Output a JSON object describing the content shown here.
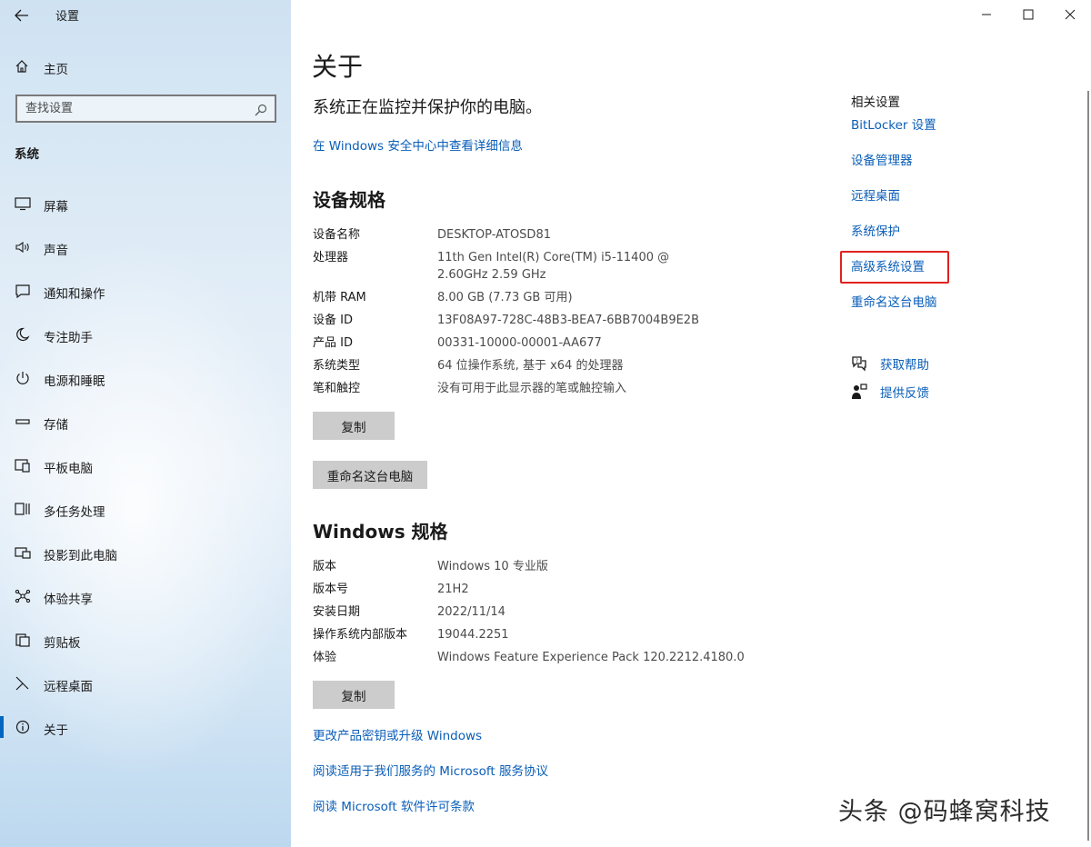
{
  "window": {
    "app_title": "设置"
  },
  "sidebar": {
    "home_label": "主页",
    "search_placeholder": "查找设置",
    "section_label": "系统",
    "items": [
      {
        "label": "屏幕",
        "icon": "monitor-icon"
      },
      {
        "label": "声音",
        "icon": "speaker-icon"
      },
      {
        "label": "通知和操作",
        "icon": "notification-icon"
      },
      {
        "label": "专注助手",
        "icon": "moon-icon"
      },
      {
        "label": "电源和睡眠",
        "icon": "power-icon"
      },
      {
        "label": "存储",
        "icon": "storage-icon"
      },
      {
        "label": "平板电脑",
        "icon": "tablet-icon"
      },
      {
        "label": "多任务处理",
        "icon": "multitask-icon"
      },
      {
        "label": "投影到此电脑",
        "icon": "projector-icon"
      },
      {
        "label": "体验共享",
        "icon": "share-icon"
      },
      {
        "label": "剪贴板",
        "icon": "clipboard-icon"
      },
      {
        "label": "远程桌面",
        "icon": "remote-icon"
      },
      {
        "label": "关于",
        "icon": "info-icon",
        "active": true
      }
    ]
  },
  "main": {
    "title": "关于",
    "subtitle": "系统正在监控并保护你的电脑。",
    "security_link": "在 Windows 安全中心中查看详细信息",
    "device_section": {
      "heading": "设备规格",
      "rows": [
        {
          "key": "设备名称",
          "value": "DESKTOP-ATOSD81"
        },
        {
          "key": "处理器",
          "value": "11th Gen Intel(R) Core(TM) i5-11400 @ 2.60GHz 2.59 GHz"
        },
        {
          "key": "机带 RAM",
          "value": "8.00 GB (7.73 GB 可用)"
        },
        {
          "key": "设备 ID",
          "value": "13F08A97-728C-48B3-BEA7-6BB7004B9E2B"
        },
        {
          "key": "产品 ID",
          "value": "00331-10000-00001-AA677"
        },
        {
          "key": "系统类型",
          "value": "64 位操作系统, 基于 x64 的处理器"
        },
        {
          "key": "笔和触控",
          "value": "没有可用于此显示器的笔或触控输入"
        }
      ],
      "copy_button": "复制",
      "rename_button": "重命名这台电脑"
    },
    "windows_section": {
      "heading": "Windows 规格",
      "rows": [
        {
          "key": "版本",
          "value": "Windows 10 专业版"
        },
        {
          "key": "版本号",
          "value": "21H2"
        },
        {
          "key": "安装日期",
          "value": "2022/11/14"
        },
        {
          "key": "操作系统内部版本",
          "value": "19044.2251"
        },
        {
          "key": "体验",
          "value": "Windows Feature Experience Pack 120.2212.4180.0"
        }
      ],
      "copy_button": "复制"
    },
    "bottom_links": [
      "更改产品密钥或升级 Windows",
      "阅读适用于我们服务的 Microsoft 服务协议",
      "阅读 Microsoft 软件许可条款"
    ]
  },
  "related": {
    "title": "相关设置",
    "links": [
      "BitLocker 设置",
      "设备管理器",
      "远程桌面",
      "系统保护",
      "高级系统设置",
      "重命名这台电脑"
    ],
    "get_help": "获取帮助",
    "feedback": "提供反馈"
  },
  "watermark": "头条 @码蜂窝科技",
  "colors": {
    "accent": "#0067c0",
    "link": "#0a5eb8",
    "highlight": "#e0221f",
    "button": "#cccccc"
  }
}
